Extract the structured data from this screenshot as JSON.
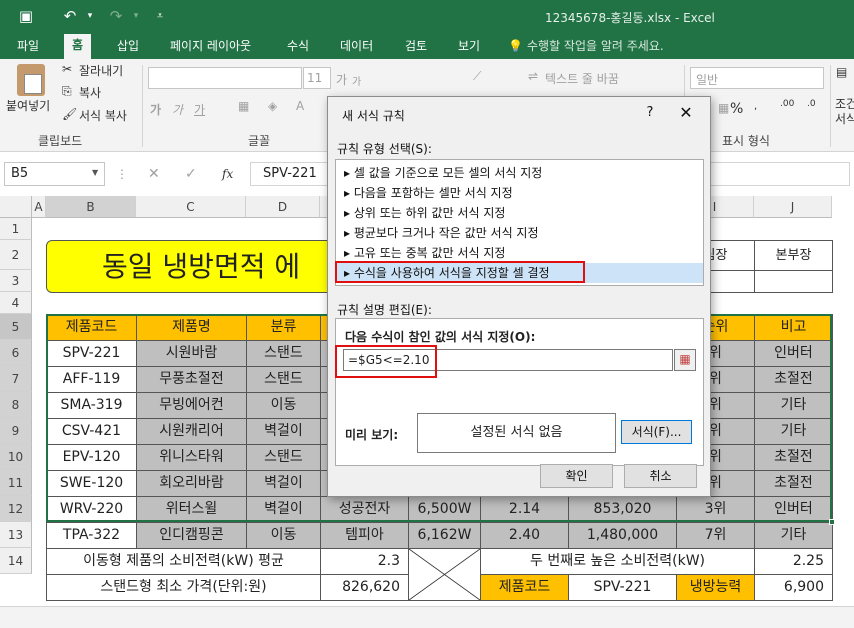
{
  "window": {
    "title": "12345678-홍길동.xlsx - Excel"
  },
  "ribbon_tabs": [
    "파일",
    "홈",
    "삽입",
    "페이지 레이아웃",
    "수식",
    "데이터",
    "검토",
    "보기"
  ],
  "tell_me": "수행할 작업을 알려 주세요.",
  "clipboard": {
    "paste": "붙여넣기",
    "cut": "잘라내기",
    "copy": "복사",
    "format_painter": "서식 복사",
    "group": "클립보드"
  },
  "font_group": {
    "size": "11",
    "group": "글꼴",
    "increase": "가",
    "decrease": "가",
    "bold": "가",
    "italic": "가",
    "underline": "가"
  },
  "align_group": {
    "wrap_text": "텍스트 줄 바꿈"
  },
  "number_group": {
    "format": "일반",
    "group": "표시 형식",
    "percent": "%"
  },
  "styles_group": {
    "label_line1": "조건",
    "label_line2": "서식"
  },
  "formula_bar": {
    "name_box": "B5",
    "fx": "fx",
    "value": "SPV-221"
  },
  "columns": [
    "A",
    "B",
    "C",
    "D",
    "E",
    "F",
    "G",
    "H",
    "I",
    "J"
  ],
  "rows": [
    "1",
    "2",
    "3",
    "4",
    "5",
    "6",
    "7",
    "8",
    "9",
    "10",
    "11",
    "12",
    "13",
    "14"
  ],
  "sheet": {
    "title": "동일 냉방면적 에",
    "approval": [
      "팀장",
      "본부장"
    ],
    "headers": [
      "제품코드",
      "제품명",
      "분류",
      "",
      "",
      "",
      "",
      "순위",
      "비고"
    ],
    "data": [
      [
        "SPV-221",
        "시원바람",
        "스탠드",
        "",
        "",
        "",
        "",
        "위",
        "인버터"
      ],
      [
        "AFF-119",
        "무풍초절전",
        "스탠드",
        "",
        "",
        "",
        "",
        "위",
        "초절전"
      ],
      [
        "SMA-319",
        "무빙에어컨",
        "이동",
        "",
        "",
        "",
        "",
        "위",
        "기타"
      ],
      [
        "CSV-421",
        "시원캐리어",
        "벽걸이",
        "",
        "",
        "",
        "",
        "위",
        "기타"
      ],
      [
        "EPV-120",
        "위니스타워",
        "스탠드",
        "",
        "",
        "",
        "",
        "위",
        "초절전"
      ],
      [
        "SWE-120",
        "회오리바람",
        "벽걸이",
        "",
        "",
        "",
        "",
        "위",
        "초절전"
      ],
      [
        "WRV-220",
        "위터스윌",
        "벽걸이",
        "성공전자",
        "6,500W",
        "2.14",
        "853,020",
        "3위",
        "인버터"
      ],
      [
        "TPA-322",
        "인디캠핑콘",
        "이동",
        "템피아",
        "6,162W",
        "2.40",
        "1,480,000",
        "7위",
        "기타"
      ]
    ],
    "summary": {
      "r13_label": "이동형 제품의 소비전력(kW) 평균",
      "r13_value": "2.3",
      "r13_label2": "두 번째로 높은 소비전력(kW)",
      "r13_value2": "2.25",
      "r14_label": "스탠드형 최소 가격(단위:원)",
      "r14_value": "826,620",
      "r14_key": "제품코드",
      "r14_key_value": "SPV-221",
      "r14_key2": "냉방능력",
      "r14_value2": "6,900"
    }
  },
  "dialog": {
    "title": "새 서식 규칙",
    "help": "?",
    "close": "✕",
    "rule_type_label": "규칙 유형 선택(S):",
    "rule_types": [
      "셀 값을 기준으로 모든 셀의 서식 지정",
      "다음을 포함하는 셀만 서식 지정",
      "상위 또는 하위 값만 서식 지정",
      "평균보다 크거나 작은 값만 서식 지정",
      "고유 또는 중복 값만 서식 지정",
      "수식을 사용하여 서식을 지정할 셀 결정"
    ],
    "edit_label": "규칙 설명 편집(E):",
    "formula_label": "다음 수식이 참인 값의 서식 지정(O):",
    "formula": "=$G5<=2.10",
    "preview_label": "미리 보기:",
    "preview_text": "설정된 서식 없음",
    "format_button": "서식(F)...",
    "ok": "확인",
    "cancel": "취소"
  },
  "colors": {
    "excel_green": "#217346",
    "header_yellow": "#ffc000",
    "title_yellow": "#ffff00",
    "row_gray": "#bfbfbf",
    "highlight_red": "#e01010"
  }
}
